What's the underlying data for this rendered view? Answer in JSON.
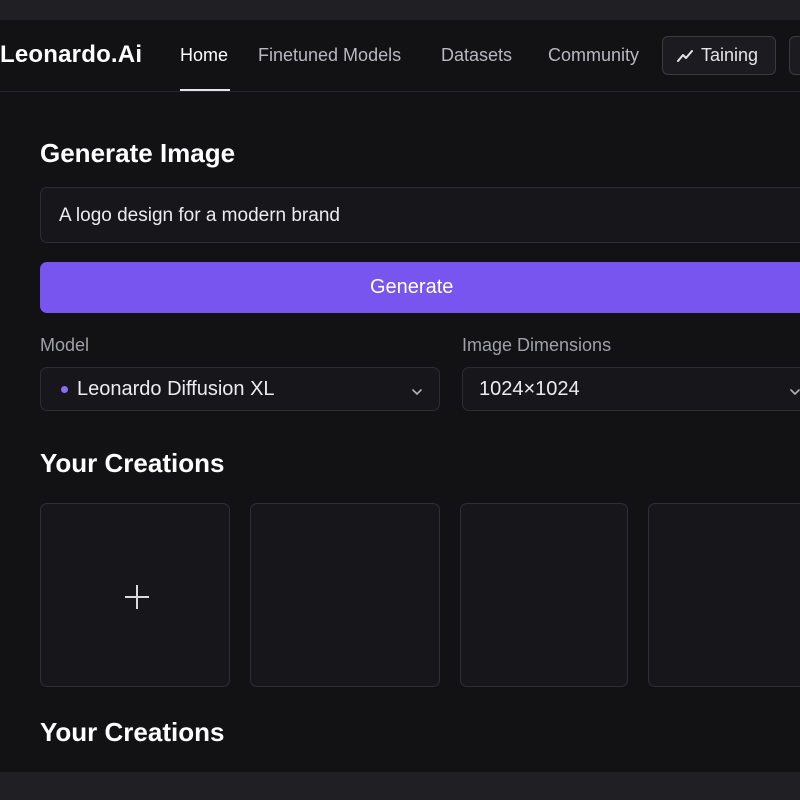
{
  "brand": {
    "name": "Leonardo.Ai"
  },
  "nav": {
    "links": [
      {
        "label": "Home",
        "active": true
      },
      {
        "label": "Finetuned Models",
        "active": false
      },
      {
        "label": "Datasets",
        "active": false
      },
      {
        "label": "Community",
        "active": false
      }
    ],
    "training_button": {
      "label": "Taining",
      "icon": "trend-up-icon"
    }
  },
  "generate": {
    "title": "Generate Image",
    "prompt_value": "A logo design for a modern brand",
    "button_label": "Generate"
  },
  "settings": {
    "model": {
      "label": "Model",
      "value": "Leonardo Diffusion XL",
      "icon": "model-dot-icon"
    },
    "dimensions": {
      "label": "Image Dimensions",
      "value": "1024×1024"
    }
  },
  "creations": {
    "title": "Your Creations",
    "add_icon": "plus-icon",
    "tiles": 4
  },
  "creations_repeat": {
    "title": "Your Creations"
  },
  "colors": {
    "background": "#121215",
    "accent": "#7755ee",
    "surface": "#17171b",
    "border": "#2e2e35"
  }
}
